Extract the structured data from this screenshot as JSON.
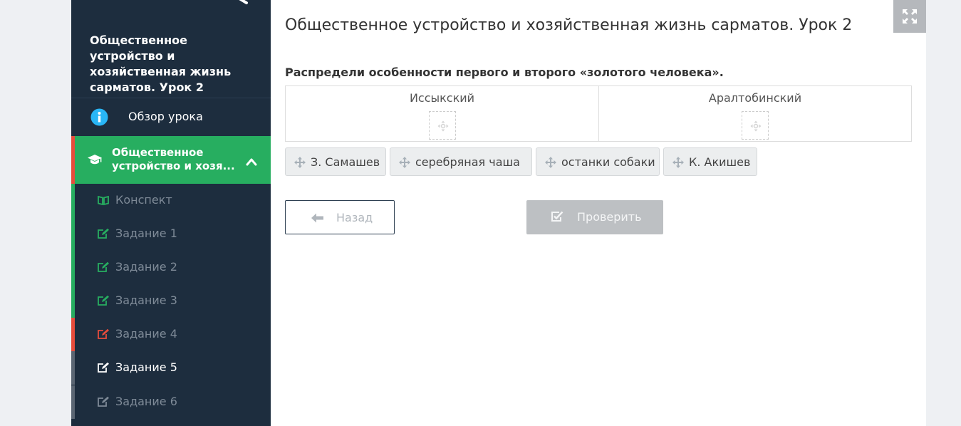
{
  "sidebar": {
    "title": "Общественное устройство и хозяйственная жизнь сарматов. Урок 2",
    "overview_label": "Обзор урока",
    "module_label": "Общественное устройство и хозя...",
    "items": [
      {
        "label": "Конспект",
        "status": "done"
      },
      {
        "label": "Задание 1",
        "status": "done"
      },
      {
        "label": "Задание 2",
        "status": "done"
      },
      {
        "label": "Задание 3",
        "status": "done"
      },
      {
        "label": "Задание 4",
        "status": "wrong"
      },
      {
        "label": "Задание 5",
        "status": "active"
      },
      {
        "label": "Задание 6",
        "status": "pending"
      }
    ],
    "colors": {
      "bg": "#1d2d3e",
      "module_bg": "#27ae60",
      "done": "#27ae60",
      "wrong": "#e74c3c",
      "info_icon": "#29b6f6"
    }
  },
  "main": {
    "title": "Общественное устройство и хозяйственная жизнь сарматов. Урок 2",
    "instruction": "Распредели особенности первого и второго «золотого человека».",
    "columns": [
      "Иссыкский",
      "Аралтобинский"
    ],
    "chips": [
      "З. Самашев",
      "серебряная чаша",
      "останки собаки",
      "К. Акишев"
    ],
    "back_label": "Назад",
    "check_label": "Проверить"
  },
  "icons": {
    "back": "arrow-left-icon",
    "fullscreen": "expand-icon",
    "info": "info-icon",
    "module": "graduation-cap-icon",
    "konspekt": "book-icon",
    "task": "edit-icon",
    "chip": "move-icon",
    "check": "check-square-icon"
  }
}
